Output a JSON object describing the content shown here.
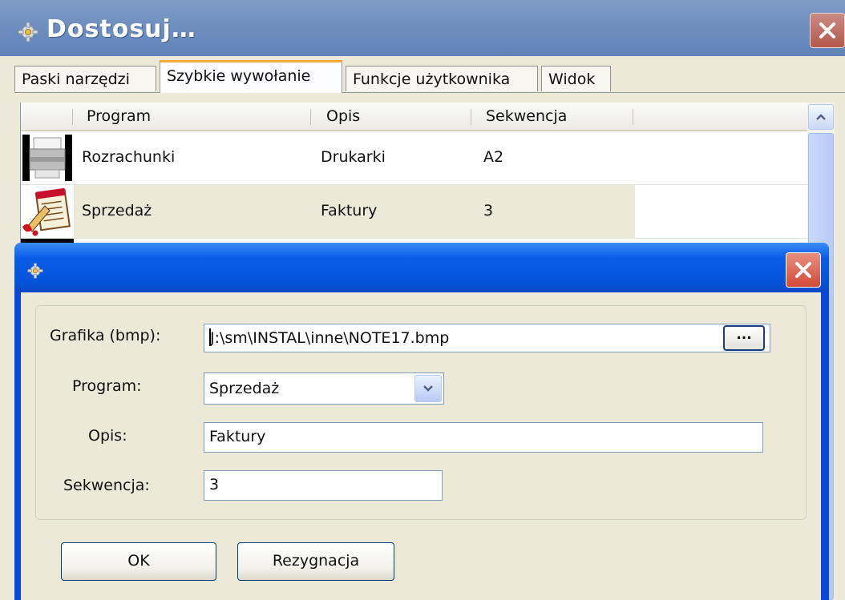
{
  "window": {
    "title": "Dostosuj…"
  },
  "tabs": [
    {
      "label": "Paski narzędzi"
    },
    {
      "label": "Szybkie wywołanie"
    },
    {
      "label": "Funkcje użytkownika"
    },
    {
      "label": "Widok"
    }
  ],
  "grid": {
    "columns": [
      "Program",
      "Opis",
      "Sekwencja"
    ],
    "rows": [
      {
        "icon": "printer-icon",
        "program": "Rozrachunki",
        "opis": "Drukarki",
        "sekwencja": "A2"
      },
      {
        "icon": "notepad-icon",
        "program": "Sprzedaż",
        "opis": "Faktury",
        "sekwencja": "3"
      }
    ]
  },
  "dialog": {
    "labels": {
      "grafika": "Grafika (bmp):",
      "program": "Program:",
      "opis": "Opis:",
      "sekwencja": "Sekwencja:"
    },
    "values": {
      "grafika": "J:\\sm\\INSTAL\\inne\\NOTE17.bmp",
      "program": "Sprzedaż",
      "opis": "Faktury",
      "sekwencja": "3"
    },
    "browse_label": "...",
    "ok_label": "OK",
    "cancel_label": "Rezygnacja"
  },
  "colors": {
    "title_bar": "#6f8fbf",
    "dialog_title": "#0453d9",
    "tab_highlight": "#f5ad3a",
    "close_red": "#d24a36"
  }
}
